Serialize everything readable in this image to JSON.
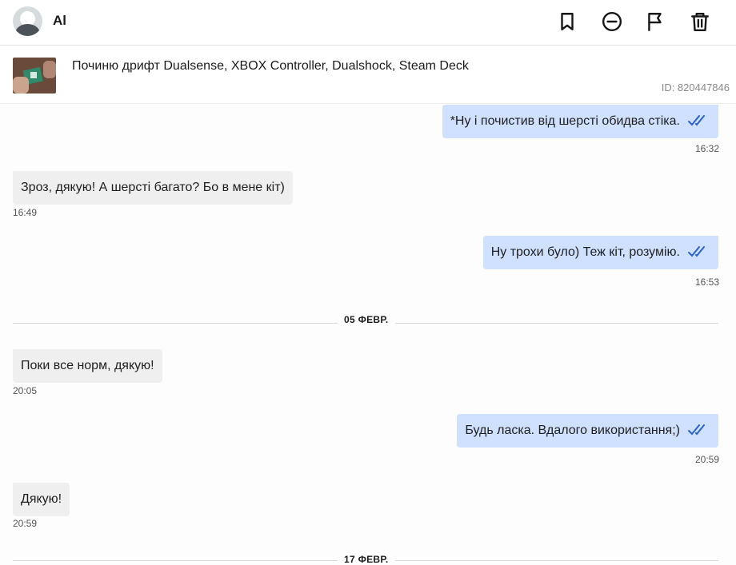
{
  "header": {
    "user_name": "Al",
    "actions": [
      {
        "name": "bookmark",
        "label": "bookmark-icon"
      },
      {
        "name": "block",
        "label": "minus-circle-icon"
      },
      {
        "name": "report",
        "label": "flag-icon"
      },
      {
        "name": "delete",
        "label": "trash-icon"
      }
    ]
  },
  "listing": {
    "title": "Починю дрифт Dualsense, XBOX Controller, Dualshock, Steam Deck",
    "id_text": "ID: 820447846"
  },
  "messages": [
    {
      "direction": "out",
      "text": "*Ну і почистив від шерсті обидва стіка.",
      "time": "16:32",
      "status": "read"
    },
    {
      "direction": "in",
      "text": "Зроз, дякую! А шерсті багато? Бо в мене кіт)",
      "time": "16:49"
    },
    {
      "direction": "out",
      "text": "Ну трохи було) Теж кіт, розумію.",
      "time": "16:53",
      "status": "read"
    },
    {
      "direction": "in",
      "text": "Поки все норм, дякую!",
      "time": "20:05"
    },
    {
      "direction": "out",
      "text": "Будь ласка. Вдалого використання;)",
      "time": "20:59",
      "status": "read"
    },
    {
      "direction": "in",
      "text": "Дякую!",
      "time": "20:59"
    }
  ],
  "date_separators": [
    "05 ФЕВР.",
    "17 ФЕВР."
  ],
  "colors": {
    "outgoing_bubble": "#cfe1ff",
    "incoming_bubble": "#efefef",
    "read_ticks": "#2b62c9"
  }
}
